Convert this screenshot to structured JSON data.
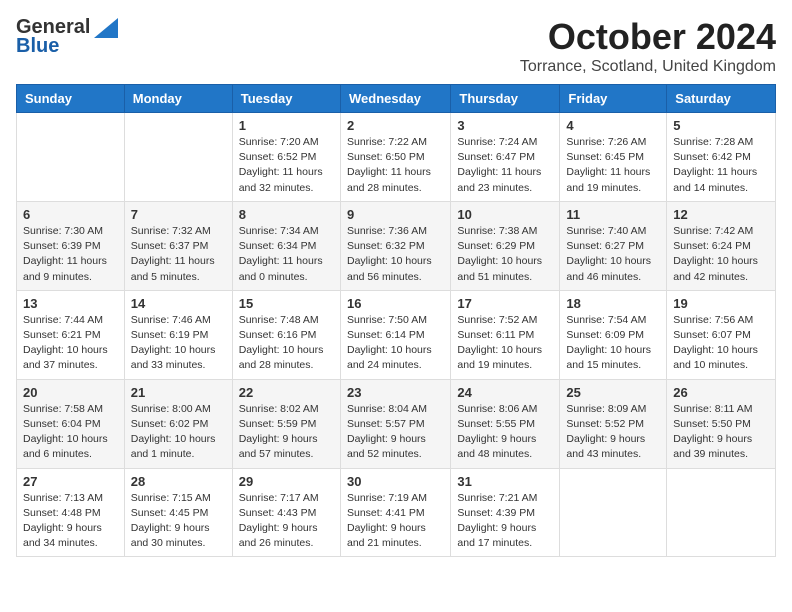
{
  "logo": {
    "general": "General",
    "blue": "Blue"
  },
  "title": "October 2024",
  "location": "Torrance, Scotland, United Kingdom",
  "days_of_week": [
    "Sunday",
    "Monday",
    "Tuesday",
    "Wednesday",
    "Thursday",
    "Friday",
    "Saturday"
  ],
  "weeks": [
    [
      {
        "day": "",
        "sunrise": "",
        "sunset": "",
        "daylight": ""
      },
      {
        "day": "",
        "sunrise": "",
        "sunset": "",
        "daylight": ""
      },
      {
        "day": "1",
        "sunrise": "Sunrise: 7:20 AM",
        "sunset": "Sunset: 6:52 PM",
        "daylight": "Daylight: 11 hours and 32 minutes."
      },
      {
        "day": "2",
        "sunrise": "Sunrise: 7:22 AM",
        "sunset": "Sunset: 6:50 PM",
        "daylight": "Daylight: 11 hours and 28 minutes."
      },
      {
        "day": "3",
        "sunrise": "Sunrise: 7:24 AM",
        "sunset": "Sunset: 6:47 PM",
        "daylight": "Daylight: 11 hours and 23 minutes."
      },
      {
        "day": "4",
        "sunrise": "Sunrise: 7:26 AM",
        "sunset": "Sunset: 6:45 PM",
        "daylight": "Daylight: 11 hours and 19 minutes."
      },
      {
        "day": "5",
        "sunrise": "Sunrise: 7:28 AM",
        "sunset": "Sunset: 6:42 PM",
        "daylight": "Daylight: 11 hours and 14 minutes."
      }
    ],
    [
      {
        "day": "6",
        "sunrise": "Sunrise: 7:30 AM",
        "sunset": "Sunset: 6:39 PM",
        "daylight": "Daylight: 11 hours and 9 minutes."
      },
      {
        "day": "7",
        "sunrise": "Sunrise: 7:32 AM",
        "sunset": "Sunset: 6:37 PM",
        "daylight": "Daylight: 11 hours and 5 minutes."
      },
      {
        "day": "8",
        "sunrise": "Sunrise: 7:34 AM",
        "sunset": "Sunset: 6:34 PM",
        "daylight": "Daylight: 11 hours and 0 minutes."
      },
      {
        "day": "9",
        "sunrise": "Sunrise: 7:36 AM",
        "sunset": "Sunset: 6:32 PM",
        "daylight": "Daylight: 10 hours and 56 minutes."
      },
      {
        "day": "10",
        "sunrise": "Sunrise: 7:38 AM",
        "sunset": "Sunset: 6:29 PM",
        "daylight": "Daylight: 10 hours and 51 minutes."
      },
      {
        "day": "11",
        "sunrise": "Sunrise: 7:40 AM",
        "sunset": "Sunset: 6:27 PM",
        "daylight": "Daylight: 10 hours and 46 minutes."
      },
      {
        "day": "12",
        "sunrise": "Sunrise: 7:42 AM",
        "sunset": "Sunset: 6:24 PM",
        "daylight": "Daylight: 10 hours and 42 minutes."
      }
    ],
    [
      {
        "day": "13",
        "sunrise": "Sunrise: 7:44 AM",
        "sunset": "Sunset: 6:21 PM",
        "daylight": "Daylight: 10 hours and 37 minutes."
      },
      {
        "day": "14",
        "sunrise": "Sunrise: 7:46 AM",
        "sunset": "Sunset: 6:19 PM",
        "daylight": "Daylight: 10 hours and 33 minutes."
      },
      {
        "day": "15",
        "sunrise": "Sunrise: 7:48 AM",
        "sunset": "Sunset: 6:16 PM",
        "daylight": "Daylight: 10 hours and 28 minutes."
      },
      {
        "day": "16",
        "sunrise": "Sunrise: 7:50 AM",
        "sunset": "Sunset: 6:14 PM",
        "daylight": "Daylight: 10 hours and 24 minutes."
      },
      {
        "day": "17",
        "sunrise": "Sunrise: 7:52 AM",
        "sunset": "Sunset: 6:11 PM",
        "daylight": "Daylight: 10 hours and 19 minutes."
      },
      {
        "day": "18",
        "sunrise": "Sunrise: 7:54 AM",
        "sunset": "Sunset: 6:09 PM",
        "daylight": "Daylight: 10 hours and 15 minutes."
      },
      {
        "day": "19",
        "sunrise": "Sunrise: 7:56 AM",
        "sunset": "Sunset: 6:07 PM",
        "daylight": "Daylight: 10 hours and 10 minutes."
      }
    ],
    [
      {
        "day": "20",
        "sunrise": "Sunrise: 7:58 AM",
        "sunset": "Sunset: 6:04 PM",
        "daylight": "Daylight: 10 hours and 6 minutes."
      },
      {
        "day": "21",
        "sunrise": "Sunrise: 8:00 AM",
        "sunset": "Sunset: 6:02 PM",
        "daylight": "Daylight: 10 hours and 1 minute."
      },
      {
        "day": "22",
        "sunrise": "Sunrise: 8:02 AM",
        "sunset": "Sunset: 5:59 PM",
        "daylight": "Daylight: 9 hours and 57 minutes."
      },
      {
        "day": "23",
        "sunrise": "Sunrise: 8:04 AM",
        "sunset": "Sunset: 5:57 PM",
        "daylight": "Daylight: 9 hours and 52 minutes."
      },
      {
        "day": "24",
        "sunrise": "Sunrise: 8:06 AM",
        "sunset": "Sunset: 5:55 PM",
        "daylight": "Daylight: 9 hours and 48 minutes."
      },
      {
        "day": "25",
        "sunrise": "Sunrise: 8:09 AM",
        "sunset": "Sunset: 5:52 PM",
        "daylight": "Daylight: 9 hours and 43 minutes."
      },
      {
        "day": "26",
        "sunrise": "Sunrise: 8:11 AM",
        "sunset": "Sunset: 5:50 PM",
        "daylight": "Daylight: 9 hours and 39 minutes."
      }
    ],
    [
      {
        "day": "27",
        "sunrise": "Sunrise: 7:13 AM",
        "sunset": "Sunset: 4:48 PM",
        "daylight": "Daylight: 9 hours and 34 minutes."
      },
      {
        "day": "28",
        "sunrise": "Sunrise: 7:15 AM",
        "sunset": "Sunset: 4:45 PM",
        "daylight": "Daylight: 9 hours and 30 minutes."
      },
      {
        "day": "29",
        "sunrise": "Sunrise: 7:17 AM",
        "sunset": "Sunset: 4:43 PM",
        "daylight": "Daylight: 9 hours and 26 minutes."
      },
      {
        "day": "30",
        "sunrise": "Sunrise: 7:19 AM",
        "sunset": "Sunset: 4:41 PM",
        "daylight": "Daylight: 9 hours and 21 minutes."
      },
      {
        "day": "31",
        "sunrise": "Sunrise: 7:21 AM",
        "sunset": "Sunset: 4:39 PM",
        "daylight": "Daylight: 9 hours and 17 minutes."
      },
      {
        "day": "",
        "sunrise": "",
        "sunset": "",
        "daylight": ""
      },
      {
        "day": "",
        "sunrise": "",
        "sunset": "",
        "daylight": ""
      }
    ]
  ]
}
